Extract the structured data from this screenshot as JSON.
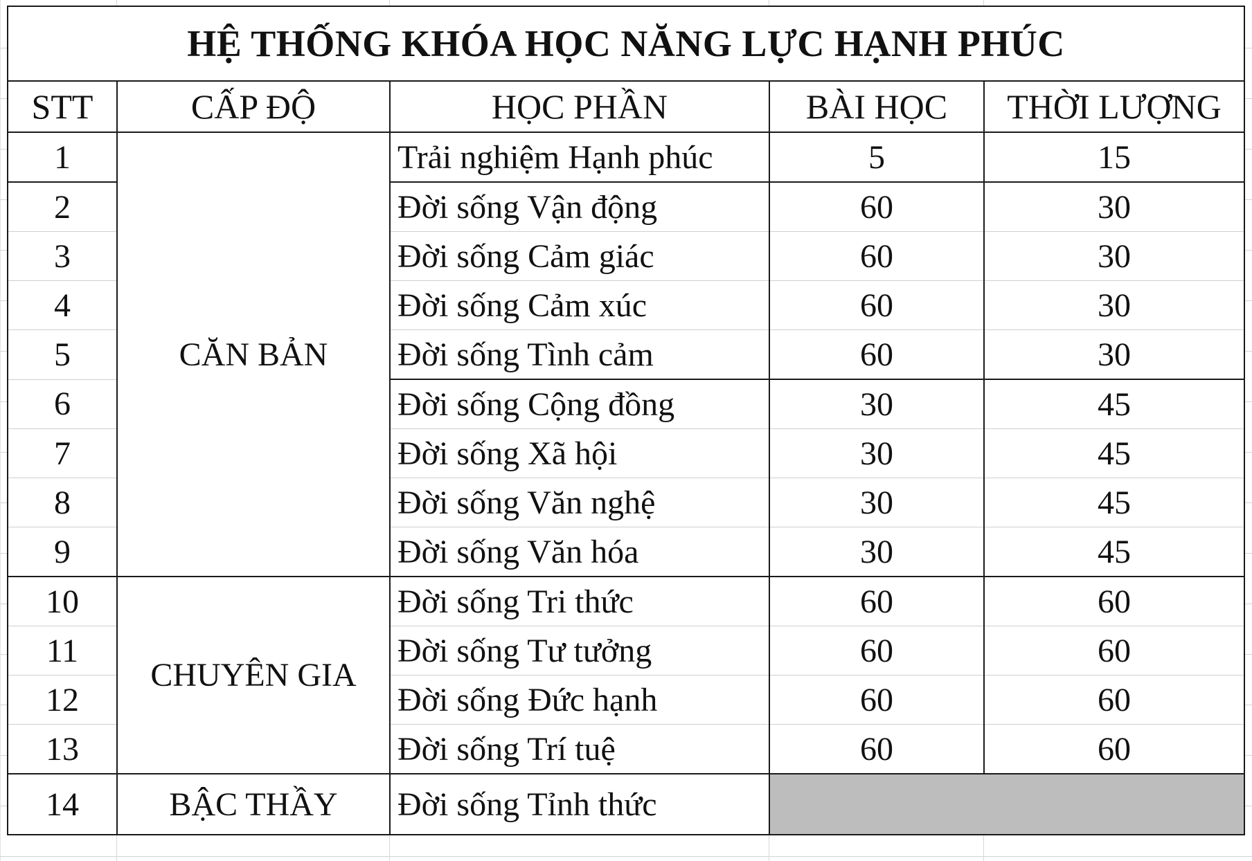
{
  "title": "HỆ THỐNG KHÓA HỌC NĂNG LỰC HẠNH PHÚC",
  "columns": {
    "stt": "STT",
    "level": "CẤP ĐỘ",
    "module": "HỌC PHẦN",
    "lessons": "BÀI HỌC",
    "duration": "THỜI LƯỢNG"
  },
  "levels": {
    "basic": "CĂN BẢN",
    "expert": "CHUYÊN GIA",
    "master": "BẬC THẦY"
  },
  "rows": [
    {
      "stt": "1",
      "module": "Trải nghiệm Hạnh phúc",
      "lessons": "5",
      "duration": "15"
    },
    {
      "stt": "2",
      "module": "Đời sống Vận động",
      "lessons": "60",
      "duration": "30"
    },
    {
      "stt": "3",
      "module": "Đời sống Cảm giác",
      "lessons": "60",
      "duration": "30"
    },
    {
      "stt": "4",
      "module": "Đời sống Cảm xúc",
      "lessons": "60",
      "duration": "30"
    },
    {
      "stt": "5",
      "module": "Đời sống Tình cảm",
      "lessons": "60",
      "duration": "30"
    },
    {
      "stt": "6",
      "module": "Đời sống Cộng đồng",
      "lessons": "30",
      "duration": "45"
    },
    {
      "stt": "7",
      "module": "Đời sống Xã hội",
      "lessons": "30",
      "duration": "45"
    },
    {
      "stt": "8",
      "module": "Đời sống Văn nghệ",
      "lessons": "30",
      "duration": "45"
    },
    {
      "stt": "9",
      "module": "Đời sống Văn hóa",
      "lessons": "30",
      "duration": "45"
    },
    {
      "stt": "10",
      "module": "Đời sống Tri thức",
      "lessons": "60",
      "duration": "60"
    },
    {
      "stt": "11",
      "module": "Đời sống Tư tưởng",
      "lessons": "60",
      "duration": "60"
    },
    {
      "stt": "12",
      "module": "Đời sống Đức hạnh",
      "lessons": "60",
      "duration": "60"
    },
    {
      "stt": "13",
      "module": "Đời sống Trí tuệ",
      "lessons": "60",
      "duration": "60"
    },
    {
      "stt": "14",
      "module": "Đời sống Tỉnh thức",
      "lessons": "",
      "duration": ""
    }
  ],
  "colors": {
    "border": "#1a1a1a",
    "gridline": "#d4d4d4",
    "empty_fill": "#bdbdbd"
  }
}
